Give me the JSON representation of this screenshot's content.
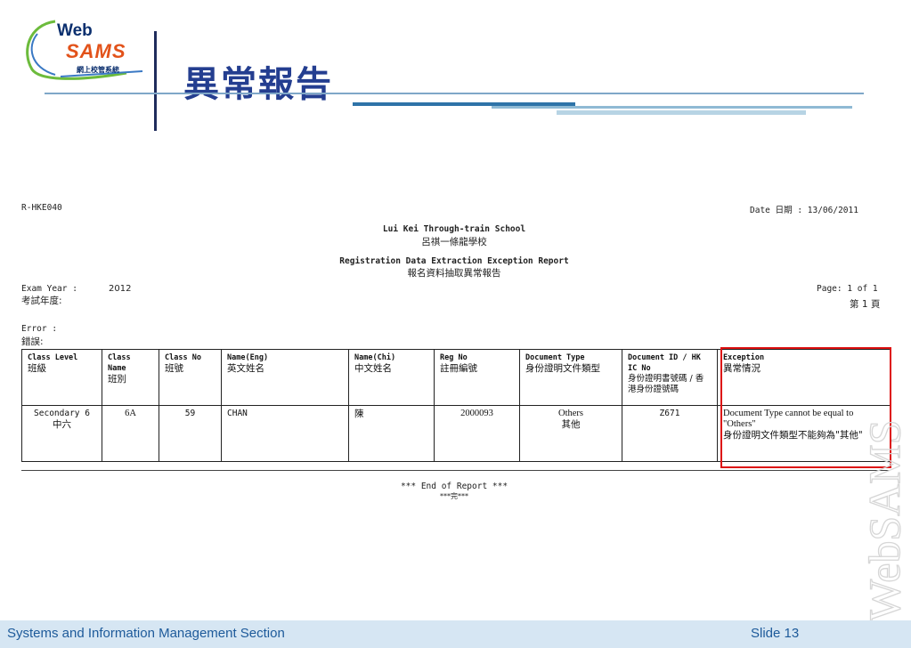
{
  "logo": {
    "web": "Web",
    "sams": "SAMS",
    "subtitle": "網上校管系統"
  },
  "slide_title": "異常報告",
  "report": {
    "code": "R-HKE040",
    "date": "Date 日期 : 13/06/2011",
    "school_en": "Lui Kei Through-train School",
    "school_zh": "呂祺一條龍學校",
    "report_title_en": "Registration Data Extraction Exception Report",
    "report_title_zh": "報名資料抽取異常報告",
    "exam_year_label_en": "Exam Year :",
    "exam_year_label_zh": "考試年度:",
    "exam_year_value": "2012",
    "page_en": "Page: 1 of 1",
    "page_zh": "第 1 頁",
    "error_label_en": "Error :",
    "error_label_zh": "錯誤:",
    "columns": [
      {
        "en": "Class Level",
        "zh": "班級"
      },
      {
        "en": "Class Name",
        "zh": "班別"
      },
      {
        "en": "Class No",
        "zh": "班號"
      },
      {
        "en": "Name(Eng)",
        "zh": "英文姓名"
      },
      {
        "en": "Name(Chi)",
        "zh": "中文姓名"
      },
      {
        "en": "Reg No",
        "zh": "註冊編號"
      },
      {
        "en": "Document Type",
        "zh": "身份證明文件類型"
      },
      {
        "en": "Document ID / HK IC No",
        "zh": "身份證明書號碼 / 香港身份證號碼"
      },
      {
        "en": "Exception",
        "zh": "異常情況"
      }
    ],
    "row": {
      "class_level_en": "Secondary 6",
      "class_level_zh": "中六",
      "class_name": "6A",
      "class_no": "59",
      "name_eng": "CHAN",
      "name_chi": "陳",
      "reg_no": "2000093",
      "doc_type_en": "Others",
      "doc_type_zh": "其他",
      "doc_id": "Z671",
      "exception_en": "Document Type cannot be equal to \"Others\"",
      "exception_zh": "身份證明文件類型不能夠為\"其他\""
    },
    "end_en": "*** End of Report ***",
    "end_zh": "***完***"
  },
  "watermark": "WebSAMS",
  "footer": {
    "section": "Systems and Information Management Section",
    "slide": "Slide 13"
  },
  "colors": {
    "title": "#243e90",
    "highlight": "#dd1111",
    "footer_bg": "#d6e6f3",
    "footer_text": "#1d5a9a"
  }
}
